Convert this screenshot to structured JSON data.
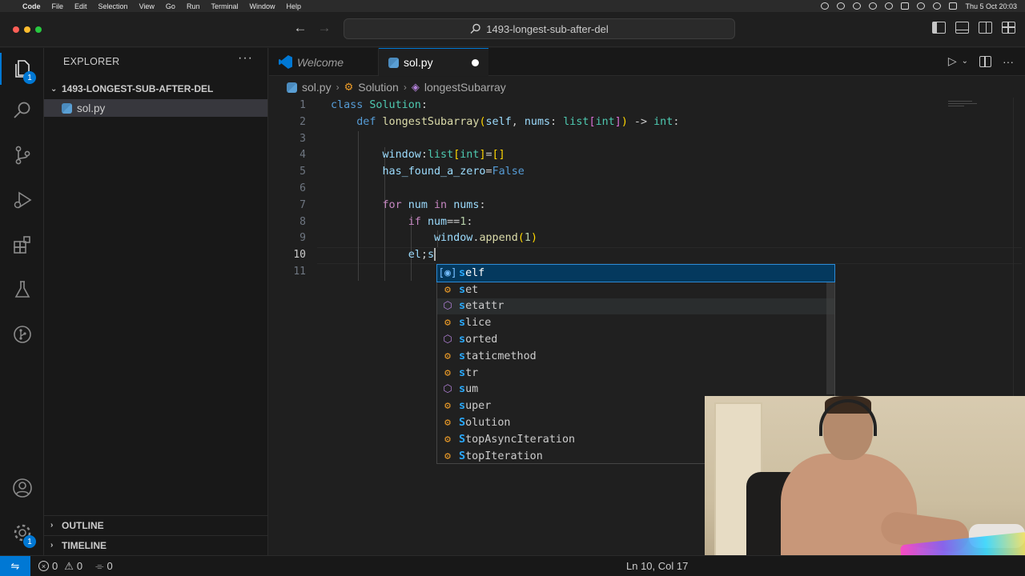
{
  "menubar": {
    "app": "Code",
    "items": [
      "File",
      "Edit",
      "Selection",
      "View",
      "Go",
      "Run",
      "Terminal",
      "Window",
      "Help"
    ],
    "clock": "Thu 5 Oct  20:03"
  },
  "titlebar": {
    "search_text": "1493-longest-sub-after-del"
  },
  "activity": {
    "explorer_badge": "1",
    "settings_badge": "1"
  },
  "sidebar": {
    "title": "EXPLORER",
    "more": "···",
    "folder": "1493-LONGEST-SUB-AFTER-DEL",
    "file": "sol.py",
    "outline": "OUTLINE",
    "timeline": "TIMELINE"
  },
  "tabs": [
    {
      "label": "Welcome"
    },
    {
      "label": "sol.py"
    }
  ],
  "breadcrumb": {
    "file": "sol.py",
    "class": "Solution",
    "method": "longestSubarray"
  },
  "editor": {
    "line_numbers": [
      "1",
      "2",
      "3",
      "4",
      "5",
      "6",
      "7",
      "8",
      "9",
      "10",
      "11"
    ],
    "current_line": 10
  },
  "suggest": {
    "items": [
      {
        "prefix": "s",
        "rest": "elf",
        "kind": "var"
      },
      {
        "prefix": "s",
        "rest": "et",
        "kind": "cls"
      },
      {
        "prefix": "s",
        "rest": "etattr",
        "kind": "fn"
      },
      {
        "prefix": "s",
        "rest": "lice",
        "kind": "cls"
      },
      {
        "prefix": "s",
        "rest": "orted",
        "kind": "fn"
      },
      {
        "prefix": "s",
        "rest": "taticmethod",
        "kind": "cls"
      },
      {
        "prefix": "s",
        "rest": "tr",
        "kind": "cls"
      },
      {
        "prefix": "s",
        "rest": "um",
        "kind": "fn"
      },
      {
        "prefix": "s",
        "rest": "uper",
        "kind": "cls"
      },
      {
        "prefix": "S",
        "rest": "olution",
        "kind": "cls"
      },
      {
        "prefix": "S",
        "rest": "topAsyncIteration",
        "kind": "cls"
      },
      {
        "prefix": "S",
        "rest": "topIteration",
        "kind": "cls"
      }
    ]
  },
  "statusbar": {
    "errors": "0",
    "warnings": "0",
    "ports": "0",
    "position": "Ln 10, Col 17"
  },
  "colors": {
    "accent": "#0078d4",
    "selection": "#04395e",
    "editor_bg": "#1f1f1f"
  }
}
